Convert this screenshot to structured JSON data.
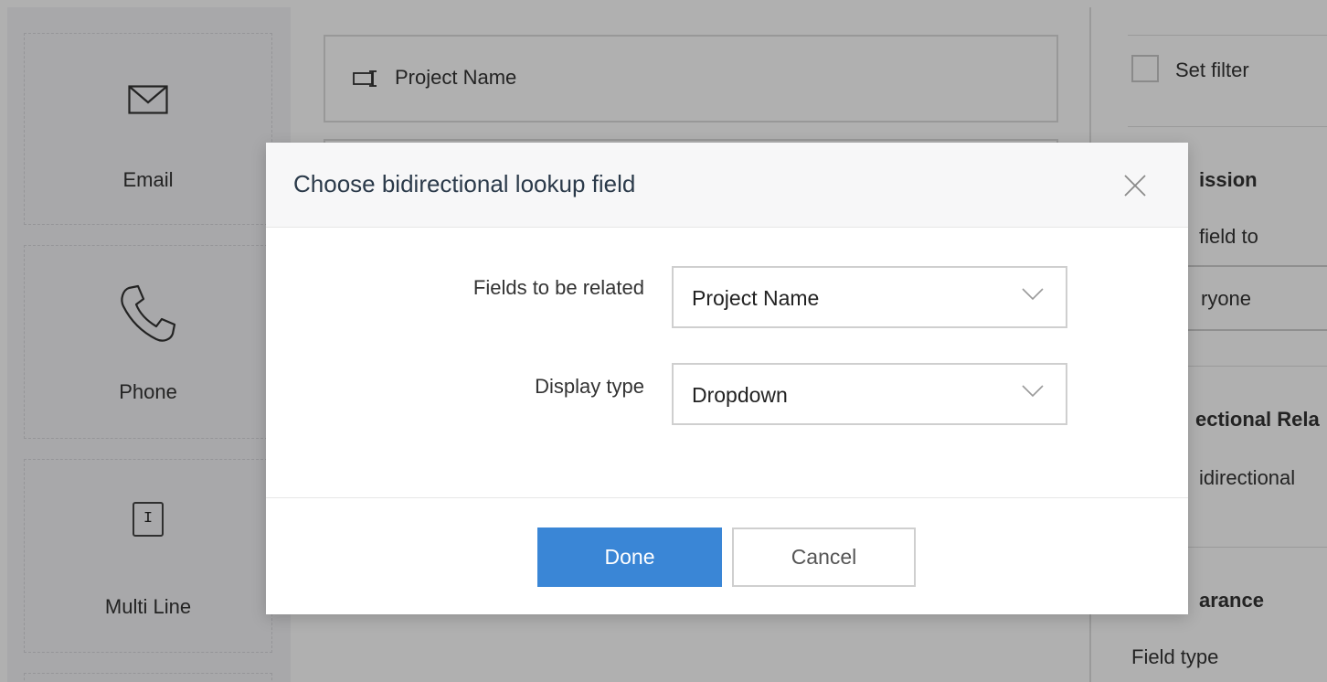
{
  "palette": {
    "items": [
      {
        "label": "Email",
        "icon": "envelope-icon"
      },
      {
        "label": "Phone",
        "icon": "phone-icon"
      },
      {
        "label": "Multi Line",
        "icon": "multi-line-icon",
        "icon_glyph": "I"
      }
    ]
  },
  "canvas": {
    "field_row_label": "Project Name",
    "field_row_icon": "lookup-field-icon"
  },
  "properties": {
    "set_filter_label": "Set filter",
    "permission_heading_partial": "ission",
    "permission_text_partial": "field to",
    "permission_select_partial": "ryone",
    "bidirectional_heading_partial": "ectional Rela",
    "bidirectional_text_partial": "idirectional",
    "appearance_heading_partial": "arance",
    "field_type_label": "Field type"
  },
  "modal": {
    "title": "Choose bidirectional lookup field",
    "close_icon": "close-icon",
    "fields": [
      {
        "label": "Fields to be related",
        "value": "Project Name"
      },
      {
        "label": "Display type",
        "value": "Dropdown"
      }
    ],
    "done_label": "Done",
    "cancel_label": "Cancel"
  },
  "colors": {
    "overlay": "#000000",
    "primary_button": "#3a86d6",
    "modal_header_bg": "#f7f7f8"
  }
}
